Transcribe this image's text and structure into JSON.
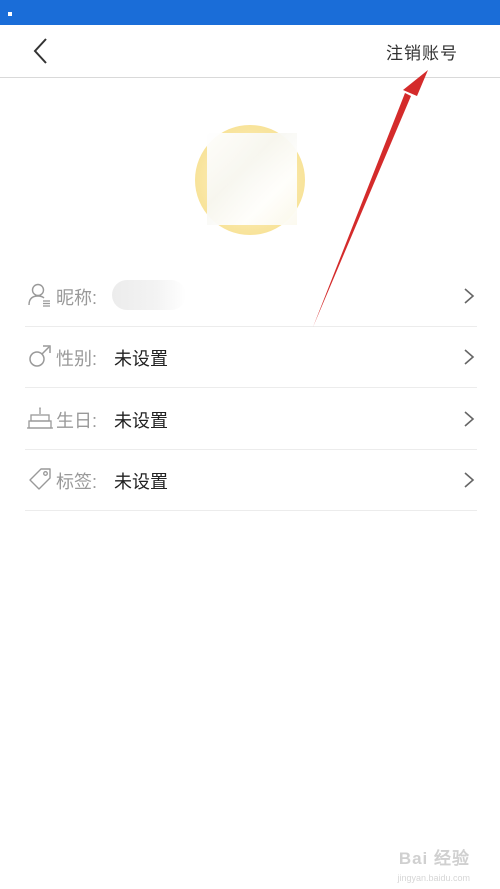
{
  "header": {
    "deregister_label": "注销账号"
  },
  "profile": {
    "rows": [
      {
        "label": "昵称:",
        "value": ""
      },
      {
        "label": "性别:",
        "value": "未设置"
      },
      {
        "label": "生日:",
        "value": "未设置"
      },
      {
        "label": "标签:",
        "value": "未设置"
      }
    ]
  },
  "icons": {
    "back": "back-arrow-icon",
    "nickname": "user-icon",
    "gender": "gender-male-icon",
    "birthday": "cake-icon",
    "tags": "tag-icon",
    "chevron": "chevron-right-icon"
  },
  "watermark": {
    "text": "Bai 经验",
    "sub": "jingyan.baidu.com"
  },
  "colors": {
    "status_bar": "#1a6dd8",
    "annotation_arrow": "#d42b2b",
    "avatar_bg": "#f8e39a"
  }
}
